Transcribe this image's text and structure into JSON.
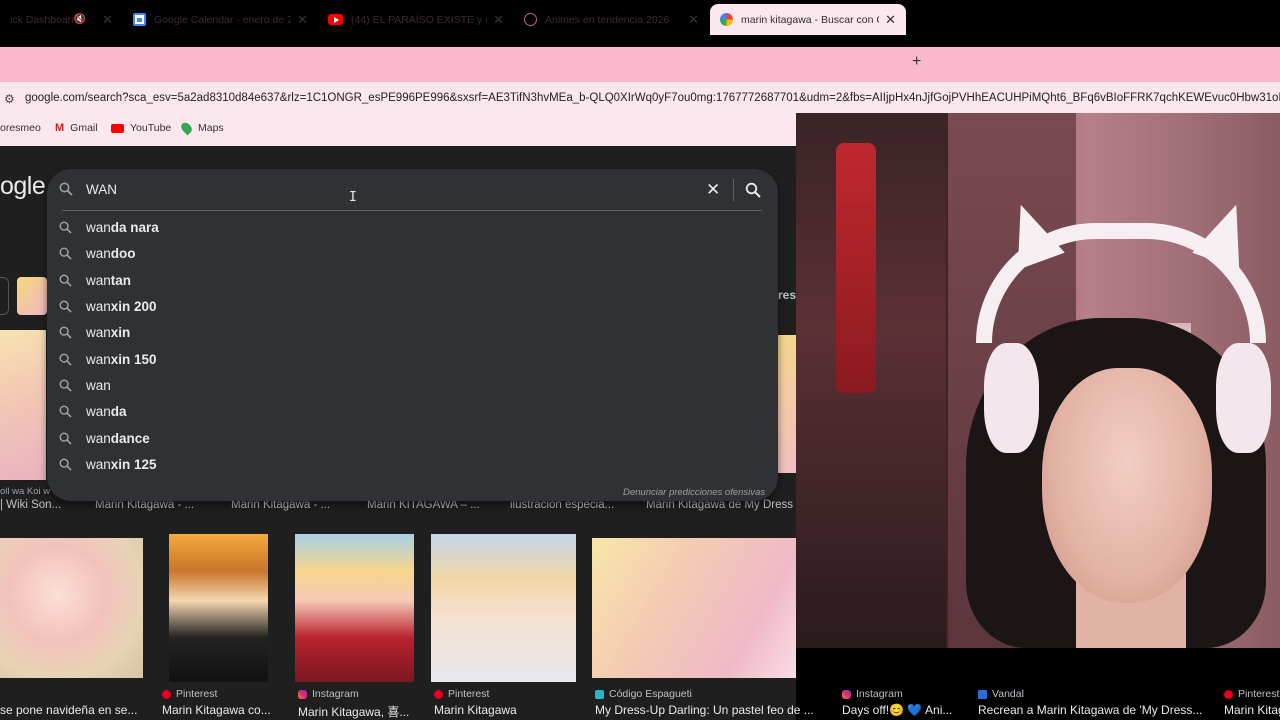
{
  "browser": {
    "tabs": [
      {
        "label": "ick Dashboard",
        "icon": "muted-speaker-icon",
        "active": false
      },
      {
        "label": "Google Calendar - enero de 20",
        "icon": "calendar-icon",
        "active": false
      },
      {
        "label": "(44) EL PARAÍSO EXISTE y está e",
        "icon": "youtube-icon",
        "active": false
      },
      {
        "label": "Animes en tendencia 2026",
        "icon": "anime-icon",
        "active": false
      },
      {
        "label": "marin kitagawa - Buscar con Go",
        "icon": "google-icon",
        "active": true
      }
    ],
    "url": "google.com/search?sca_esv=5a2ad8310d84e637&rlz=1C1ONGR_esPE996PE996&sxsrf=AE3TifN3hvMEa_b-QLQ0XIrWq0yF7ou0mg:1767772687701&udm=2&fbs=AIIjpHx4nJjfGojPVHhEACUHPiMQht6_BFq6vBIoFFRK7qchKEWEvuc0Hbw31oEI7c8o3y",
    "bookmarks": [
      {
        "label": "oresmeo",
        "icon": ""
      },
      {
        "label": "Gmail",
        "icon": "gmail-icon"
      },
      {
        "label": "YouTube",
        "icon": "youtube-icon"
      },
      {
        "label": "Maps",
        "icon": "maps-icon"
      }
    ]
  },
  "google": {
    "logo_partial": "ogle",
    "search": {
      "query": "WAN",
      "suggestions": [
        {
          "prefix": "wan",
          "rest": "da nara"
        },
        {
          "prefix": "wan",
          "rest": "doo"
        },
        {
          "prefix": "wan",
          "rest": "tan"
        },
        {
          "prefix": "wan",
          "rest": "xin 200"
        },
        {
          "prefix": "wan",
          "rest": "xin"
        },
        {
          "prefix": "wan",
          "rest": "xin 150"
        },
        {
          "prefix": "wan",
          "rest": ""
        },
        {
          "prefix": "wan",
          "rest": "da"
        },
        {
          "prefix": "wan",
          "rest": "dance"
        },
        {
          "prefix": "wan",
          "rest": "xin 125"
        }
      ],
      "report_link": "Denunciar predicciones ofensivas"
    },
    "chip_partial": "res",
    "row1_partial_text": "oll wa Koi w",
    "row1_captions": [
      "| Wiki Son...",
      "Marin Kitagawa - ...",
      "Marin Kitagawa - ...",
      "Marin KITAGAWA – ...",
      "ilustracion especia...",
      "Marin Kitagawa de My Dress"
    ],
    "row2_results": [
      {
        "source": "",
        "source_icon": "",
        "caption": "se pone navideña en se..."
      },
      {
        "source": "Pinterest",
        "source_icon": "pinterest-icon",
        "caption": "Marin Kitagawa co..."
      },
      {
        "source": "Instagram",
        "source_icon": "instagram-icon",
        "caption": "Marin Kitagawa, 喜..."
      },
      {
        "source": "Pinterest",
        "source_icon": "pinterest-icon",
        "caption": "Marin Kitagawa"
      },
      {
        "source": "Código Espagueti",
        "source_icon": "codigo-espagueti-icon",
        "caption": "My Dress-Up Darling: Un pastel feo de ..."
      },
      {
        "source": "Instagram",
        "source_icon": "instagram-icon",
        "caption": "Days off!😊 💙 Ani..."
      },
      {
        "source": "Vandal",
        "source_icon": "vandal-icon",
        "caption": "Recrean a Marin Kitagawa de 'My Dress..."
      },
      {
        "source": "Pinterest",
        "source_icon": "pinterest-icon",
        "caption": "Marin Kitag"
      }
    ]
  },
  "colors": {
    "tab_strip": "#f9b9cb",
    "toolbar": "#fde7ee",
    "page_bg": "#1f1f1f",
    "search_box": "#303134"
  }
}
